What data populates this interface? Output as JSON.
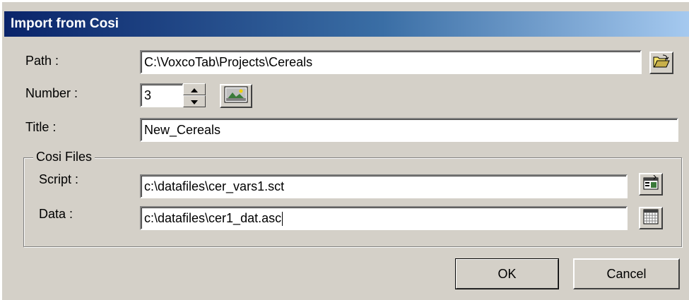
{
  "dialog": {
    "title": "Import from Cosi"
  },
  "path": {
    "label": "Path :",
    "value": "C:\\VoxcoTab\\Projects\\Cereals",
    "browse_icon": "folder-open-icon"
  },
  "number": {
    "label": "Number :",
    "value": "3",
    "picker_icon": "image-picker-icon"
  },
  "title": {
    "label": "Title :",
    "value": "New_Cereals"
  },
  "cosi_files": {
    "group_label": "Cosi Files",
    "script": {
      "label": "Script :",
      "value": "c:\\datafiles\\cer_vars1.sct",
      "icon": "script-file-icon"
    },
    "data": {
      "label": "Data :",
      "value": "c:\\datafiles\\cer1_dat.asc",
      "icon": "data-grid-icon"
    }
  },
  "buttons": {
    "ok": "OK",
    "cancel": "Cancel"
  },
  "colors": {
    "title_gradient_start": "#0a246a",
    "title_gradient_end": "#a6caf0",
    "face": "#d4d0c8"
  }
}
